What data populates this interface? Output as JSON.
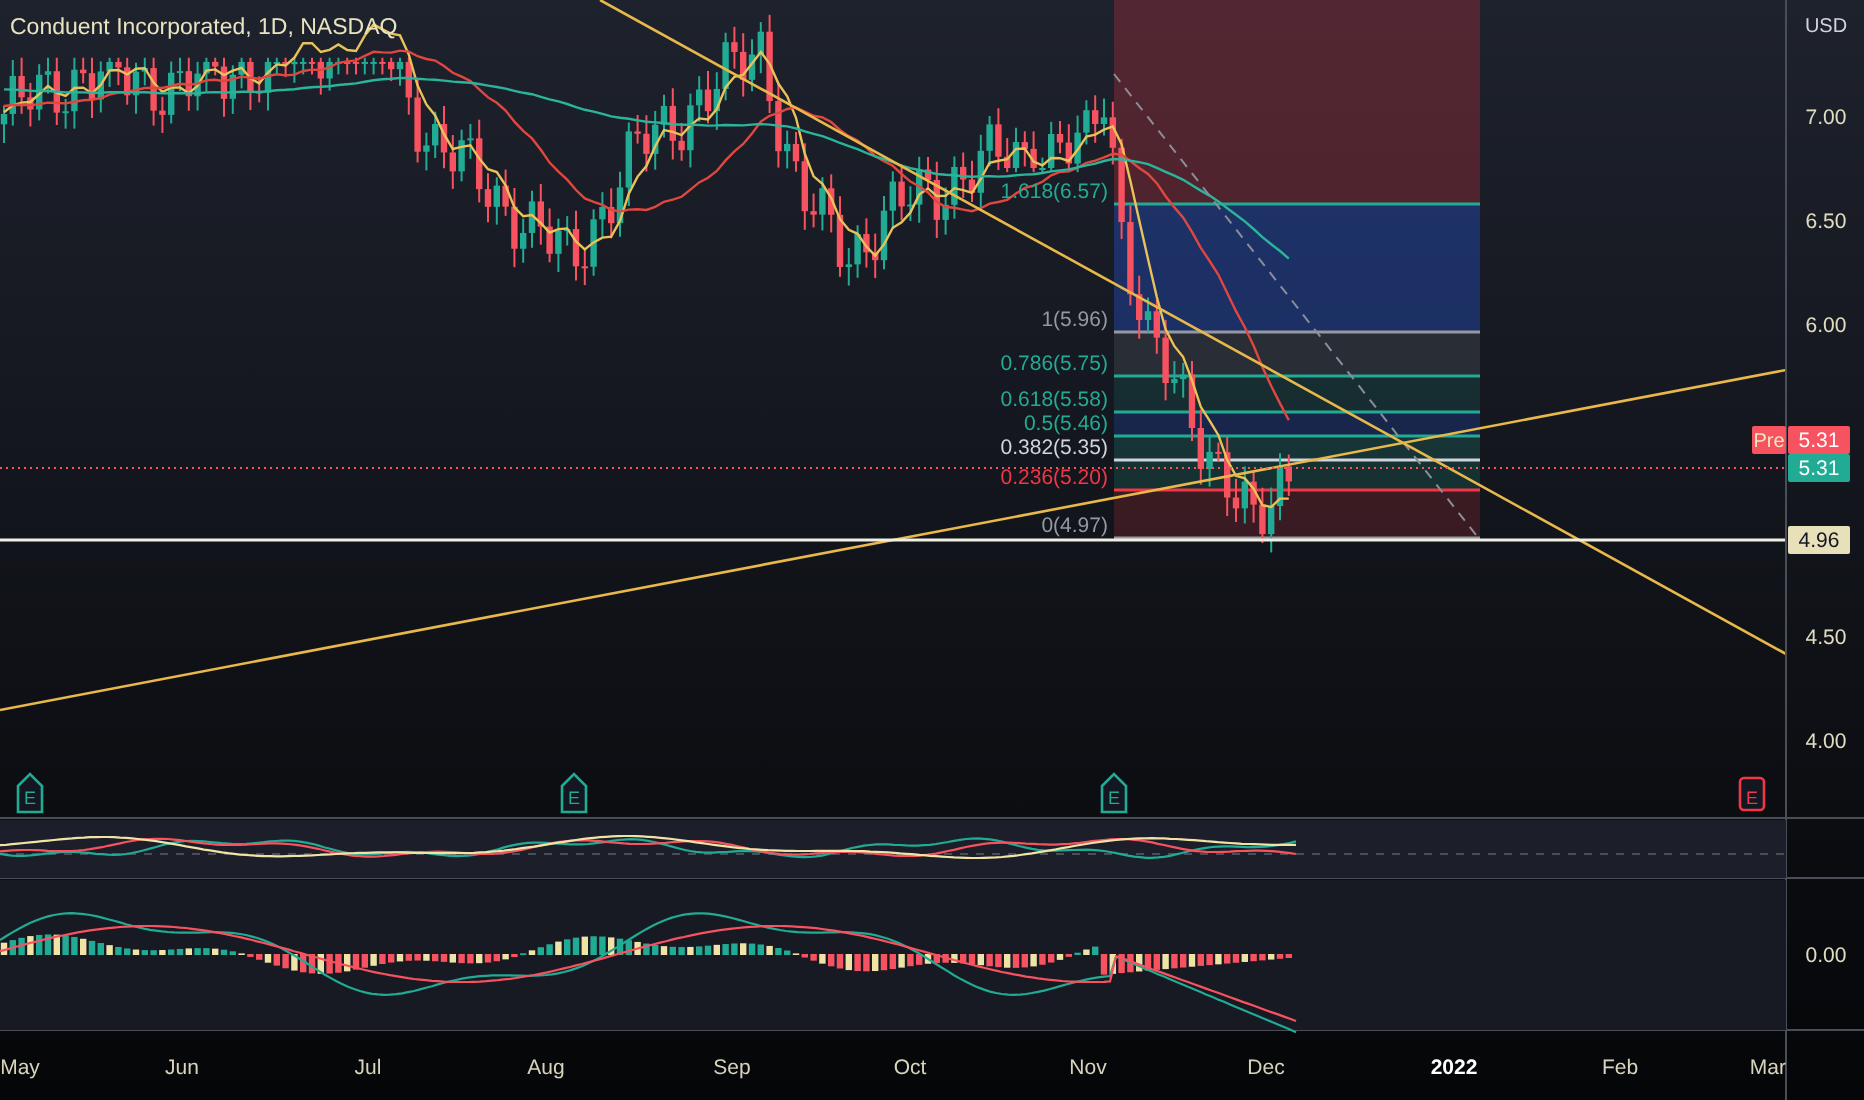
{
  "chart": {
    "title": "Conduent Incorporated, 1D, NASDAQ",
    "currency": "USD",
    "price_labels": [
      "7.00",
      "6.50",
      "6.00",
      "4.50",
      "4.00"
    ],
    "time_labels": [
      {
        "text": "May",
        "year": false
      },
      {
        "text": "Jun",
        "year": false
      },
      {
        "text": "Jul",
        "year": false
      },
      {
        "text": "Aug",
        "year": false
      },
      {
        "text": "Sep",
        "year": false
      },
      {
        "text": "Oct",
        "year": false
      },
      {
        "text": "Nov",
        "year": false
      },
      {
        "text": "Dec",
        "year": false
      },
      {
        "text": "2022",
        "year": true
      },
      {
        "text": "Feb",
        "year": false
      },
      {
        "text": "Mar",
        "year": false
      }
    ],
    "fib_levels": [
      {
        "label": "1.618(6.57)",
        "color": "#22ab94"
      },
      {
        "label": "1(5.96)",
        "color": "#9598a1"
      },
      {
        "label": "0.786(5.75)",
        "color": "#22ab94"
      },
      {
        "label": "0.618(5.58)",
        "color": "#22ab94"
      },
      {
        "label": "0.5(5.46)",
        "color": "#22ab94"
      },
      {
        "label": "0.382(5.35)",
        "color": "#d1d4dc"
      },
      {
        "label": "0.236(5.20)",
        "color": "#f23645"
      },
      {
        "label": "0(4.97)",
        "color": "#9598a1"
      }
    ],
    "price_tags": [
      {
        "kind": "pre",
        "label": "Pre",
        "value": "5.31"
      },
      {
        "kind": "last",
        "value": "5.31"
      },
      {
        "kind": "line",
        "value": "4.96"
      }
    ],
    "earnings": [
      {
        "label": "E",
        "color": "#22ab94"
      },
      {
        "label": "E",
        "color": "#22ab94"
      },
      {
        "label": "E",
        "color": "#22ab94"
      },
      {
        "label": "E",
        "color": "#f23645"
      }
    ],
    "macd_labels": [
      "0.00"
    ]
  }
}
